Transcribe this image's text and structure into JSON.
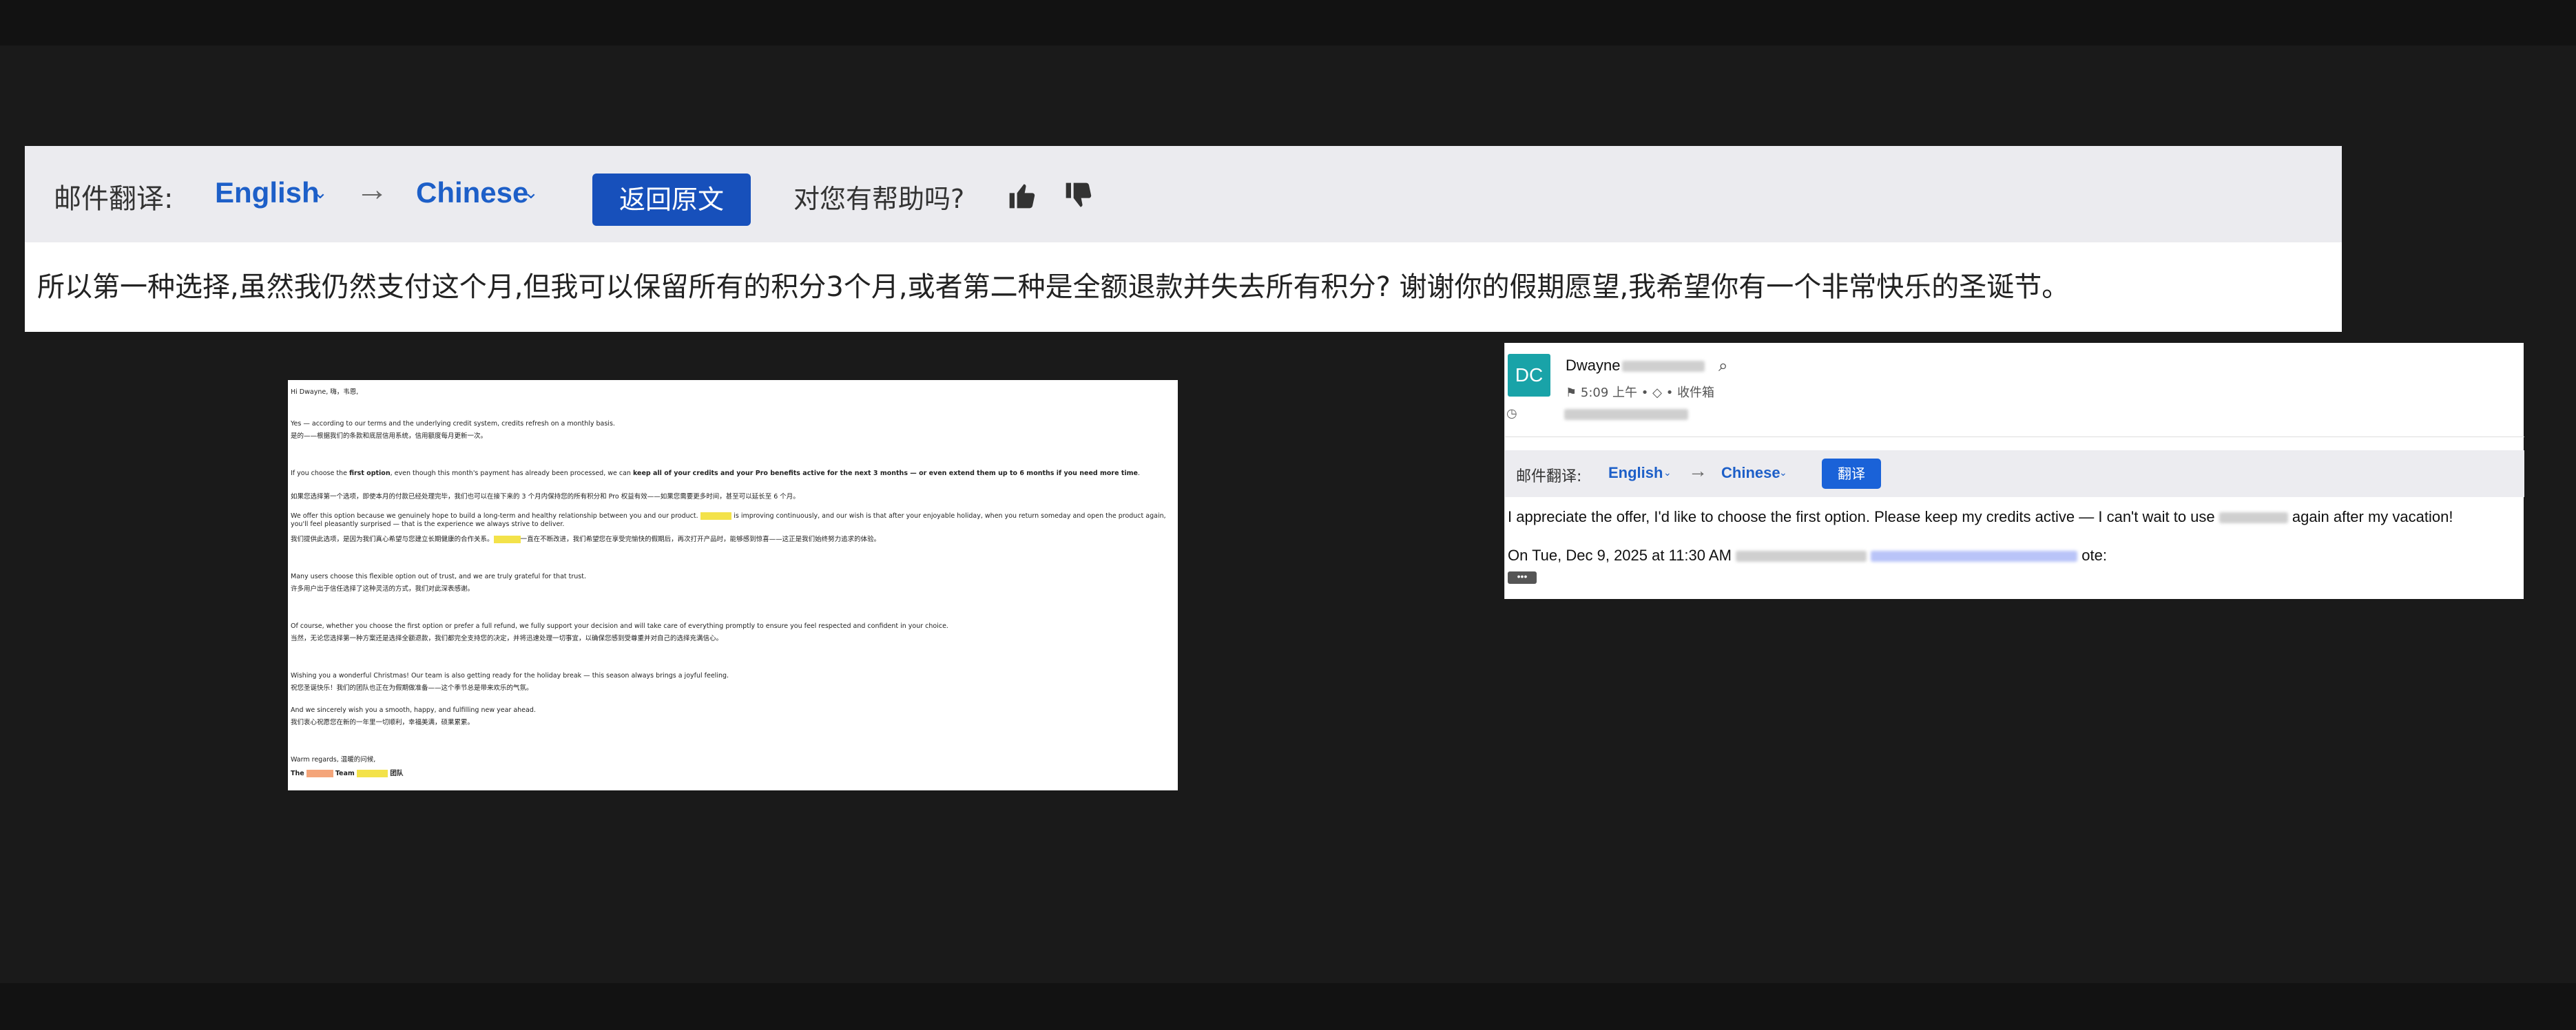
{
  "big_panel": {
    "label": "邮件翻译:",
    "from_lang": "English",
    "to_lang": "Chinese",
    "arrow": "→",
    "back_button": "返回原文",
    "help_question": "对您有帮助吗?",
    "translated_text": "所以第一种选择,虽然我仍然支付这个月,但我可以保留所有的积分3个月,或者第二种是全额退款并失去所有积分? 谢谢你的假期愿望,我希望你有一个非常快乐的圣诞节。"
  },
  "email_doc": {
    "greeting": "Hi Dwayne,  嗨，韦恩,",
    "p1_en": "Yes — according to our terms and the underlying credit system, credits refresh on a monthly basis.",
    "p1_zh": "是的——根据我们的条款和底层信用系统，信用额度每月更新一次。",
    "p2_en_a": "If you choose the ",
    "p2_en_b": "first option",
    "p2_en_c": ", even though this month's payment has already been processed, we can ",
    "p2_en_d": "keep all of your credits and your Pro benefits active for the next 3 months — or even extend them up to 6 months if you need more time",
    "p2_en_e": ".",
    "p2_zh": "如果您选择第一个选项，即使本月的付款已经处理完毕，我们也可以在接下来的 3 个月内保持您的所有积分和 Pro 权益有效——如果您需要更多时间，甚至可以延长至 6 个月。",
    "p3_en_a": "We offer this option because we genuinely hope to build a long-term and healthy relationship between you and our product.",
    "p3_en_b": " is improving continuously, and our wish is that after your enjoyable holiday, when you return someday and open the product again, you'll feel pleasantly surprised — that is the experience we always strive to deliver.",
    "p3_zh": "我们提供此选项，是因为我们真心希望与您建立长期健康的合作关系。",
    "p3_zh_b": "一直在不断改进，我们希望您在享受完愉快的假期后，再次打开产品时，能够感到惊喜——这正是我们始终努力追求的体验。",
    "p4_en": "Many users choose this flexible option out of trust, and we are truly grateful for that trust.",
    "p4_zh": "许多用户出于信任选择了这种灵活的方式，我们对此深表感谢。",
    "p5_en": "Of course, whether you choose the first option or prefer a full refund, we fully support your decision and will take care of everything promptly to ensure you feel respected and confident in your choice.",
    "p5_zh": "当然，无论您选择第一种方案还是选择全额退款，我们都完全支持您的决定，并将迅速处理一切事宜，以确保您感到受尊重并对自己的选择充满信心。",
    "p6_en": "Wishing you a wonderful Christmas! Our team is also getting ready for the holiday break — this season always brings a joyful feeling.",
    "p6_zh": "祝您圣诞快乐！我们的团队也正在为假期做准备——这个季节总是带来欢乐的气氛。",
    "p7_en": "And we sincerely wish you a smooth, happy, and fulfilling new year ahead.",
    "p7_zh": "我们衷心祝愿您在新的一年里一切顺利，幸福美满，硕果累累。",
    "signoff": "Warm regards,  温暖的问候,",
    "team_a": "The",
    "team_b": "Team",
    "team_c": "团队"
  },
  "client": {
    "avatar": "DC",
    "sender": "Dwayne",
    "time": "5:09 上午",
    "folder": "收件箱",
    "label": "邮件翻译:",
    "from_lang": "English",
    "to_lang": "Chinese",
    "arrow": "→",
    "translate_button": "翻译",
    "body_a": "I appreciate the offer, I'd like to choose the first option. Please keep my credits active — I can't wait to use",
    "body_b": "again after my vacation!",
    "quote_a": "On Tue, Dec 9, 2025 at 11:30 AM",
    "quote_b": "ote:",
    "ellipsis": "•••"
  }
}
